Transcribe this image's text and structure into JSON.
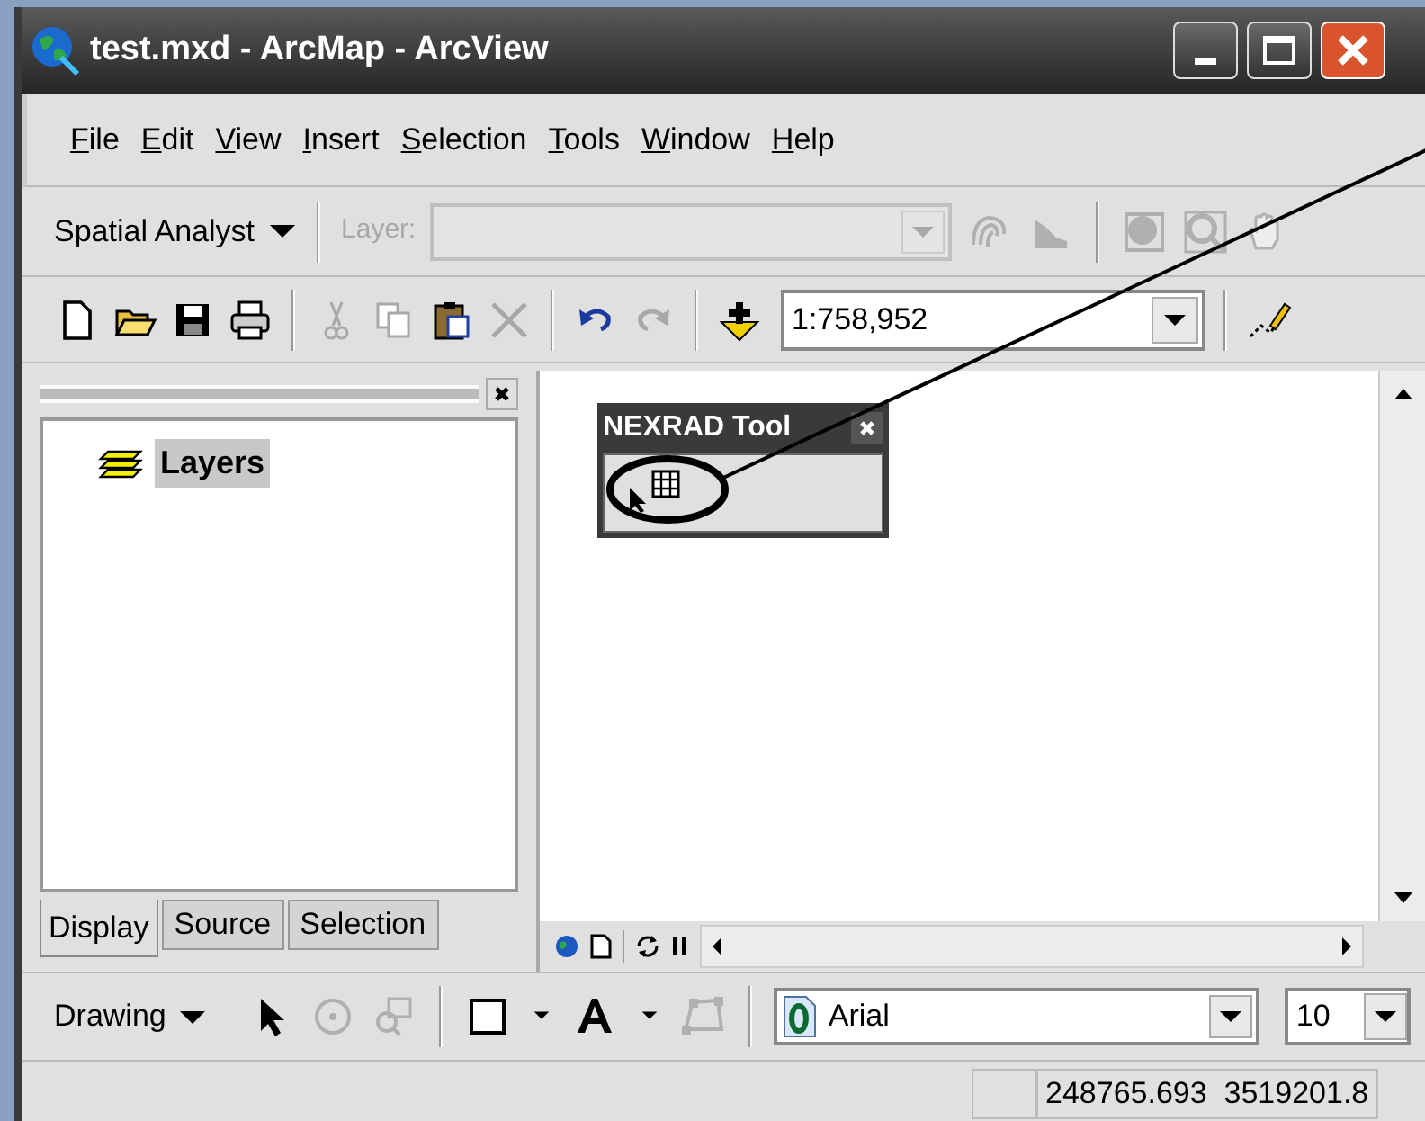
{
  "window": {
    "title": "test.mxd - ArcMap - ArcView"
  },
  "menu_bar": [
    {
      "label": "File"
    },
    {
      "label": "Edit"
    },
    {
      "label": "View"
    },
    {
      "label": "Insert"
    },
    {
      "label": "Selection"
    },
    {
      "label": "Tools"
    },
    {
      "label": "Window"
    },
    {
      "label": "Help"
    }
  ],
  "spatial_toolbar": {
    "menu": "Spatial Analyst",
    "layer_label": "Layer:",
    "layer_disabled": true,
    "tools": [
      {
        "disabled": true
      },
      {
        "disabled": true
      },
      {
        "disabled": true
      },
      {
        "disabled": true
      },
      {
        "disabled": true
      }
    ]
  },
  "standard_toolbar": {
    "tools": [
      {
        "disabled": false
      },
      {
        "disabled": false
      },
      {
        "disabled": false
      },
      {
        "disabled": false
      },
      {
        "disabled": true
      },
      {
        "disabled": true
      },
      {
        "disabled": false
      },
      {
        "disabled": true
      },
      {
        "disabled": false
      },
      {
        "disabled": true
      },
      {
        "disabled": false
      }
    ],
    "scale": "1:758,952",
    "editor_disabled": false
  },
  "toc": {
    "layers": [
      {
        "label": "Layers",
        "selected": true
      }
    ],
    "tabs": [
      {
        "label": "Display",
        "selected": true
      },
      {
        "label": "Source",
        "selected": false
      },
      {
        "label": "Selection",
        "selected": false
      }
    ]
  },
  "nexrad_toolbar": {
    "title": "NEXRAD Tool",
    "tools": [
      {
        "disabled": false
      }
    ]
  },
  "drawing_toolbar": {
    "menu": "Drawing",
    "tools": [
      {
        "disabled": false
      },
      {
        "disabled": true
      },
      {
        "disabled": true
      },
      {
        "disabled": false
      },
      {
        "disabled": false
      },
      {
        "disabled": false
      },
      {
        "disabled": false
      },
      {
        "disabled": true
      }
    ],
    "font": "Arial",
    "size": "10"
  },
  "status_bar": {
    "coordinates": "248765.693  3519201.8"
  }
}
